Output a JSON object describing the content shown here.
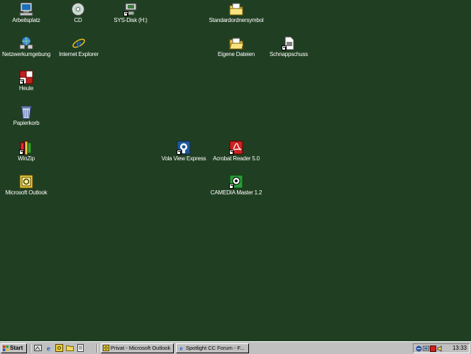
{
  "desktop": {
    "icons": [
      {
        "label": "Arbeitsplatz"
      },
      {
        "label": "CD"
      },
      {
        "label": "SYS-Disk (H:)"
      },
      {
        "label": "Standardordnersymbol"
      },
      {
        "label": "Netzwerkumgebung"
      },
      {
        "label": "Internet Explorer"
      },
      {
        "label": "Eigene Dateien"
      },
      {
        "label": "Schnappschuss"
      },
      {
        "label": "Heute"
      },
      {
        "label": "Papierkorb"
      },
      {
        "label": "WinZip"
      },
      {
        "label": "Vola View Express"
      },
      {
        "label": "Acrobat Reader 5.0"
      },
      {
        "label": "Microsoft Outlook"
      },
      {
        "label": "CAMEDIA Master 1.2"
      }
    ]
  },
  "taskbar": {
    "start_label": "Start",
    "tasks": [
      {
        "label": "Privat - Microsoft Outlook"
      },
      {
        "label": "Spotlight CC Forum - F..."
      }
    ],
    "clock": "13:33"
  },
  "colors": {
    "desktop_background": "#203f22",
    "taskbar": "#c0c0c0"
  }
}
